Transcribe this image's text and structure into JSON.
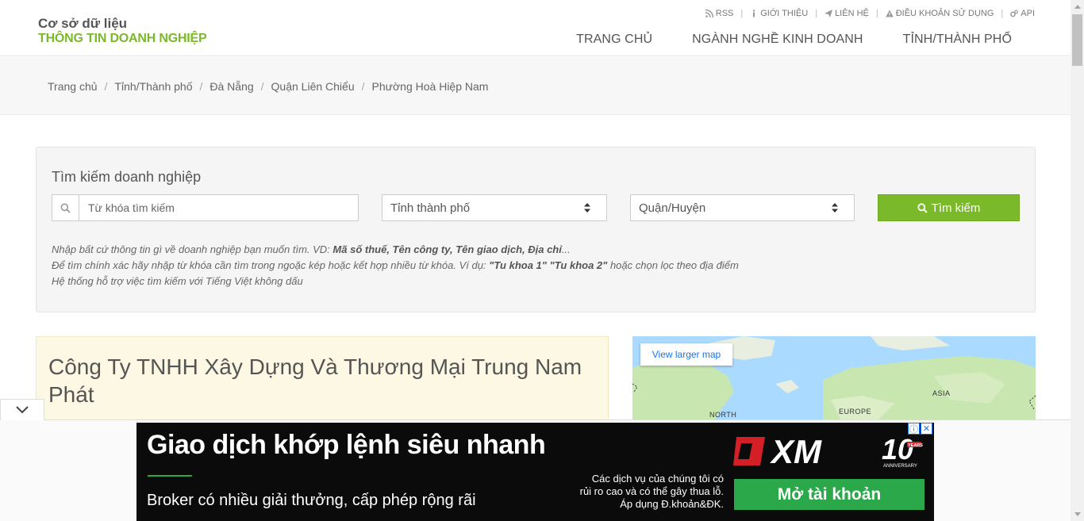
{
  "logo": {
    "line1": "Cơ sở dữ liệu",
    "line2": "THÔNG TIN DOANH NGHIỆP"
  },
  "toplinks": [
    {
      "label": "RSS",
      "icon": "rss-icon"
    },
    {
      "label": "GIỚI THIỆU",
      "icon": "info-icon"
    },
    {
      "label": "LIÊN HỆ",
      "icon": "paper-plane-icon"
    },
    {
      "label": "ĐIỀU KHOẢN SỬ DỤNG",
      "icon": "warning-icon"
    },
    {
      "label": "API",
      "icon": "gears-icon"
    }
  ],
  "mainnav": [
    "TRANG CHỦ",
    "NGÀNH NGHỀ KINH DOANH",
    "TỈNH/THÀNH PHỐ"
  ],
  "breadcrumb": [
    "Trang chủ",
    "Tỉnh/Thành phố",
    "Đà Nẵng",
    "Quận Liên Chiểu",
    "Phường Hoà Hiệp Nam"
  ],
  "search": {
    "title": "Tìm kiếm doanh nghiệp",
    "placeholder": "Từ khóa tìm kiếm",
    "province": "Tỉnh thành phố",
    "district": "Quận/Huyện",
    "button": "Tìm kiếm",
    "hint1_prefix": "Nhập bất cứ thông tin gì về doanh nghiệp bạn muốn tìm. VD: ",
    "hint1_bold": "Mã số thuế, Tên công ty, Tên giao dịch, Địa chỉ",
    "hint1_suffix": "...",
    "hint2_prefix": "Để tìm chính xác hãy nhập từ khóa cần tìm trong ngoặc kép hoặc kết hợp nhiều từ khóa. Ví dụ: ",
    "hint2_bold": "\"Tu khoa 1\" \"Tu khoa 2\"",
    "hint2_suffix": " hoặc chọn lọc theo địa điểm",
    "hint3": "Hệ thống hỗ trợ việc tìm kiếm với Tiếng Việt không dấu"
  },
  "company": {
    "name": "Công Ty TNHH Xây Dựng Và Thương Mại Trung Nam Phát"
  },
  "map": {
    "view_larger": "View larger map",
    "labels": [
      "NORTH",
      "EUROPE",
      "ASIA"
    ]
  },
  "ad": {
    "headline": "Giao dịch khớp lệnh siêu nhanh",
    "sub": "Broker có nhiều giải thưởng, cấp phép rộng rãi",
    "disclaimer1": "Các dịch vụ của chúng tôi có",
    "disclaimer2": "rủi ro cao và có thể gây thua lỗ.",
    "disclaimer3": "Áp dụng Đ.khoản&ĐK.",
    "cta": "Mở tài khoản",
    "brand": "XM",
    "anniv": "10",
    "anniv_sub": "YEARS",
    "anniv_word": "ANNIVERSARY"
  }
}
